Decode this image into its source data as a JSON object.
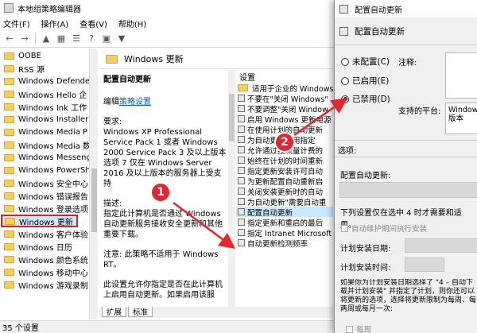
{
  "window": {
    "title": "本地组策略编辑器"
  },
  "menu": [
    "文件(F)",
    "操作(A)",
    "查看(V)",
    "帮助(H)"
  ],
  "toolbar": {
    "icons": [
      "back-icon",
      "forward-icon",
      "folder-up-icon",
      "properties-icon",
      "show-hide-tree-icon",
      "help-icon",
      "console-icon",
      "filter-icon"
    ]
  },
  "tree": {
    "items": [
      "OOBE",
      "RSS 源",
      "Windows Defende",
      "Windows Hello 企",
      "Windows Ink 工作",
      "Windows Installer",
      "Windows Media P",
      "Windows Media 数",
      "Windows Messeng",
      "Windows PowerSh",
      "Windows 安全中心",
      "Windows 错误报告",
      "Windows 登录选项",
      "Windows 更新",
      "Windows 客户体验",
      "Windows 日历",
      "Windows 颜色系统",
      "Windows 移动中心",
      "Windows 游戏录制"
    ],
    "selected_index": 13
  },
  "pane_header": "Windows 更新",
  "description": {
    "title": "配置自动更新",
    "edit_prefix": "编辑",
    "edit_link": "策略设置",
    "requirements_label": "要求:",
    "requirements": "Windows XP Professional Service Pack 1 或者 Windows 2000 Service Pack 3 及以上版本 选项 7 仅在 Windows Server 2016 及以上版本的服务器上受支持",
    "desc_label": "描述:",
    "desc": "指定此计算机是否通过 Windows 自动更新服务接收安全更新和其他重要下载。",
    "note": "注意: 此策略不适用于 Windows RT。",
    "more": "此设置允许你指定是否在此计算机上启用自动更新。如果启用该服"
  },
  "settings": {
    "column_header": "设置",
    "rows": [
      "适用于企业的 Windows",
      "不要在\"关闭 Windows\"",
      "不要调整\"关闭 Window",
      "启用 Windows 更新电源",
      "在使用计划的自动更新",
      "为自动更新启用指定",
      "允许通过按流量计费的",
      "始终在计划的时间重新",
      "指定更新安装许可自动",
      "为更新配置自动重新启",
      "关闭安装更新时的自动",
      "为自动更新\"需要自动重",
      "配置自动更新",
      "指定更新和重启的最后",
      "指定 Intranet Microsoft",
      "自动更新检测频率"
    ],
    "selected_index": 12
  },
  "tabs": [
    "扩展",
    "标准"
  ],
  "status": "35 个设置",
  "dialog": {
    "title": "配置自动更新",
    "heading": "配置自动更新",
    "radios": [
      "未配置(C)",
      "已启用(E)",
      "已禁用(D)"
    ],
    "selected_radio": 2,
    "comment_label": "注释:",
    "platform_label": "支持的平台:",
    "platform_text": "Windows 版本",
    "options_label": "选项:",
    "configure_label": "配置自动更新:",
    "apply_note": "下列设置仅在选中 4 时才需要和适用。",
    "install_maintenance": "自动维护期间执行安装",
    "schedule_day": "计划安装日期:",
    "schedule_time": "计划安装时间:",
    "help_text": "如果你为计划安装日期选择了 \"4 – 自动下载并计划安装\" 并指定了计划，则你还可以将更新的选项，选择将更新限制为每周、每两周或每月一次:",
    "weekly": "每周"
  },
  "badges": [
    "1",
    "2"
  ],
  "colors": {
    "selection": "#cce8ff",
    "highlight_border": "#e02020",
    "badge": "#e5242b",
    "link": "#0d5fb5"
  }
}
